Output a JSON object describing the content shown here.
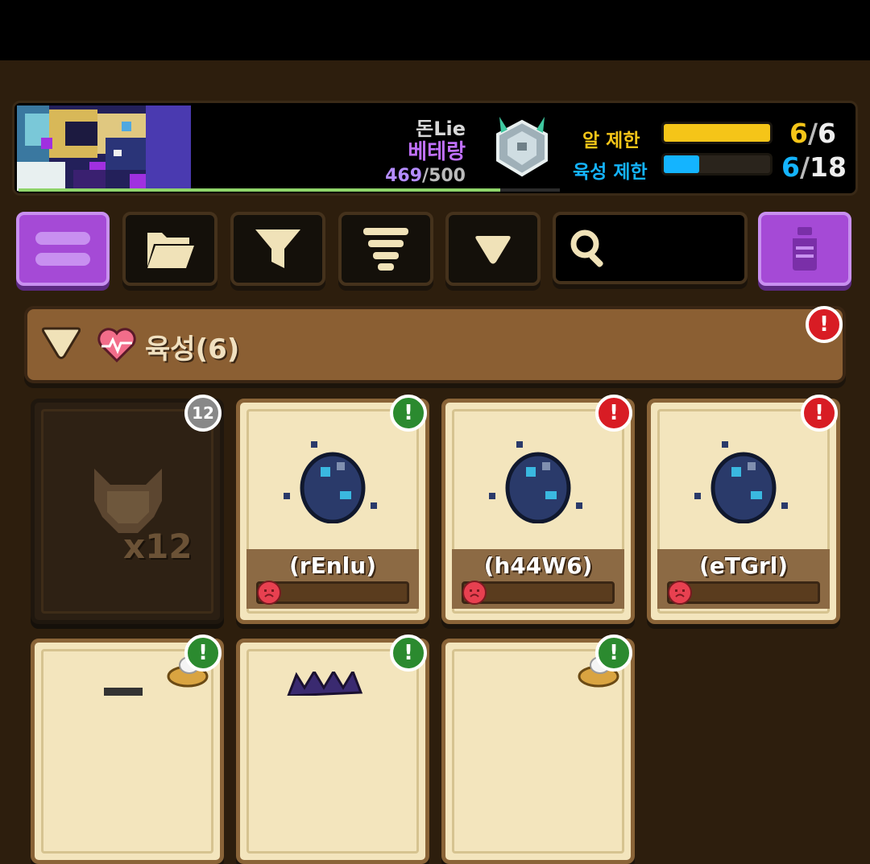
{
  "profile": {
    "name_line1": "돈Lie",
    "name_line2": "베테랑",
    "count_current": "469",
    "count_max": "/500",
    "xp_fraction": 0.89,
    "egg_limit_label": "알 제한",
    "egg_limit_current": "6",
    "egg_limit_max": "6",
    "egg_limit_fraction": 1.0,
    "raise_limit_label": "육성 제한",
    "raise_limit_current": "6",
    "raise_limit_max": "18",
    "raise_limit_fraction": 0.33,
    "colors": {
      "egg_bar": "#f5c518",
      "raise_bar": "#14b4ff",
      "egg_label": "#f5c518",
      "raise_label": "#14b4ff"
    }
  },
  "toolbar": {
    "menu_icon": "hamburger-icon",
    "folder_icon": "folder-icon",
    "filter_icon": "funnel-icon",
    "sort_icon": "sort-icon",
    "dropdown_icon": "triangle-down-icon",
    "search_icon": "search-icon",
    "search_value": "",
    "potion_icon": "bottle-icon"
  },
  "section": {
    "title": "육성",
    "count": "(6)",
    "alert": "!"
  },
  "cards": [
    {
      "type": "locked",
      "badge": "12",
      "count_label": "x12"
    },
    {
      "type": "egg",
      "name": "(rEnlu)",
      "badge": "!",
      "badge_color": "green"
    },
    {
      "type": "egg",
      "name": "(h44W6)",
      "badge": "!",
      "badge_color": "red"
    },
    {
      "type": "egg",
      "name": "(eTGrl)",
      "badge": "!",
      "badge_color": "red"
    }
  ],
  "cards_row2": [
    {
      "badge": "!",
      "badge_color": "green"
    },
    {
      "badge": "!",
      "badge_color": "green"
    },
    {
      "badge": "!",
      "badge_color": "green"
    }
  ]
}
